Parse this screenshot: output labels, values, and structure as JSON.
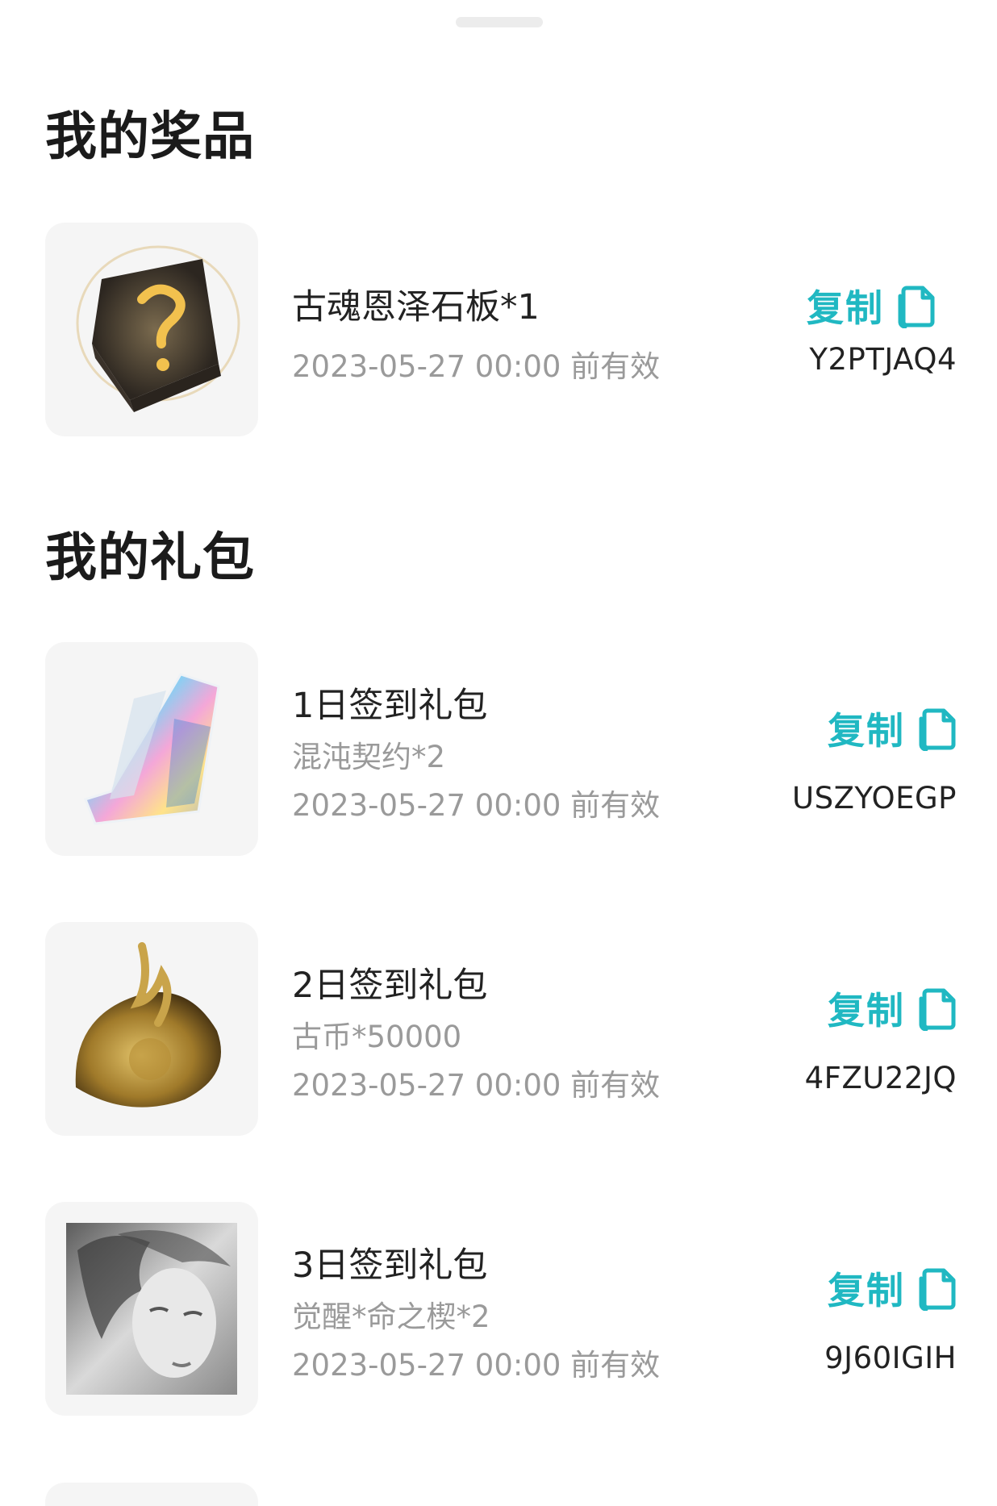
{
  "sections": {
    "prizes_title": "我的奖品",
    "gifts_title": "我的礼包"
  },
  "copy_label": "复制",
  "prizes": [
    {
      "name": "古魂恩泽石板*1",
      "expiry": "2023-05-27 00:00 前有效",
      "code": "Y2PTJAQ4",
      "icon": "rune-tablet-image"
    }
  ],
  "gifts": [
    {
      "name": "1日签到礼包",
      "content": "混沌契约*2",
      "expiry": "2023-05-27 00:00 前有效",
      "code": "USZYOEGP",
      "icon": "crystal-shard-image"
    },
    {
      "name": "2日签到礼包",
      "content": "古币*50000",
      "expiry": "2023-05-27 00:00 前有效",
      "code": "4FZU22JQ",
      "icon": "gold-coin-image"
    },
    {
      "name": "3日签到礼包",
      "content": "觉醒*命之楔*2",
      "expiry": "2023-05-27 00:00 前有效",
      "code": "9J60IGIH",
      "icon": "portrait-image"
    }
  ],
  "colors": {
    "accent": "#20b8c2",
    "muted_text": "#9a9a9a",
    "card_bg": "#f5f5f5"
  }
}
